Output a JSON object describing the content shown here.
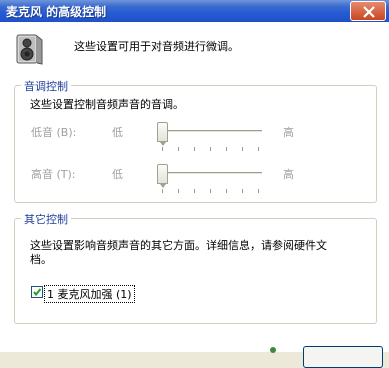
{
  "window": {
    "title": "麦克风 的高级控制"
  },
  "intro_text": "这些设置可用于对音频进行微调。",
  "tone_group": {
    "legend": "音调控制",
    "description": "这些设置控制音频声音的音调。",
    "sliders": [
      {
        "label": "低音 (B):",
        "low": "低",
        "high": "高",
        "level": 0.0
      },
      {
        "label": "高音 (T):",
        "low": "低",
        "high": "高",
        "level": 0.0
      }
    ]
  },
  "other_group": {
    "legend": "其它控制",
    "description_line1": "这些设置影响音频声音的其它方面。详细信息，请参阅硬件文",
    "description_line2": "档。",
    "checkbox": {
      "label": "1  麦克风加强 (1)",
      "checked": true
    }
  },
  "colors": {
    "titlebar": "#245bd3",
    "legend_text": "#1e3e9e",
    "disabled_text": "#a0a0a0"
  }
}
